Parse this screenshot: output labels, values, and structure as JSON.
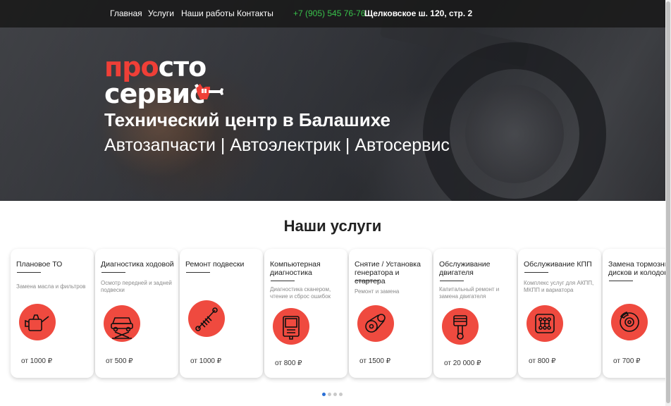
{
  "nav": {
    "items": [
      "Главная",
      "Услуги",
      "Наши работы",
      "Контакты"
    ],
    "phone": "+7 (905) 545 76-76",
    "address": "Щелковское ш. 120, стр. 2"
  },
  "logo": {
    "part1": "про",
    "part2": "сто",
    "part3": "сервис"
  },
  "hero": {
    "title": "Технический центр в Балашихе",
    "subtitle": "Автозапчасти | Автоэлектрик | Автосервис"
  },
  "services": {
    "title": "Наши услуги",
    "cards": [
      {
        "title": "Плановое ТО",
        "desc": "Замена масла и фильтров",
        "icon": "oil-can-icon",
        "price": "от 1000 ₽"
      },
      {
        "title": "Диагностика ходовой",
        "desc": "Осмотр передней и задней подвески",
        "icon": "car-lift-icon",
        "price": "от 500 ₽"
      },
      {
        "title": "Ремонт подвески",
        "desc": "",
        "icon": "shock-absorber-icon",
        "price": "от 1000 ₽"
      },
      {
        "title": "Компьютерная диагностика",
        "desc": "Диагностика сканером, чтение и сброс ошибок",
        "icon": "diagnostic-scanner-icon",
        "price": "от 800 ₽"
      },
      {
        "title": "Снятие / Установка генератора и стартера",
        "desc": "Ремонт и замена",
        "icon": "timing-belt-icon",
        "price": "от 1500 ₽"
      },
      {
        "title": "Обслуживание двигателя",
        "desc": "Капитальный ремонт и замена двигателя",
        "icon": "piston-icon",
        "price": "от 20 000 ₽"
      },
      {
        "title": "Обслуживание КПП",
        "desc": "Комплекс услуг для АКПП, МКПП и вариатора",
        "icon": "gearbox-icon",
        "price": "от 800 ₽"
      },
      {
        "title": "Замена тормозных дисков и колодок",
        "desc": "",
        "icon": "brake-disc-icon",
        "price": "от 700 ₽"
      }
    ]
  },
  "colors": {
    "accent": "#ef4a3f",
    "phone": "#39c24b",
    "active_dot": "#2a6fd6"
  },
  "carousel": {
    "pages": 4,
    "active": 0
  }
}
